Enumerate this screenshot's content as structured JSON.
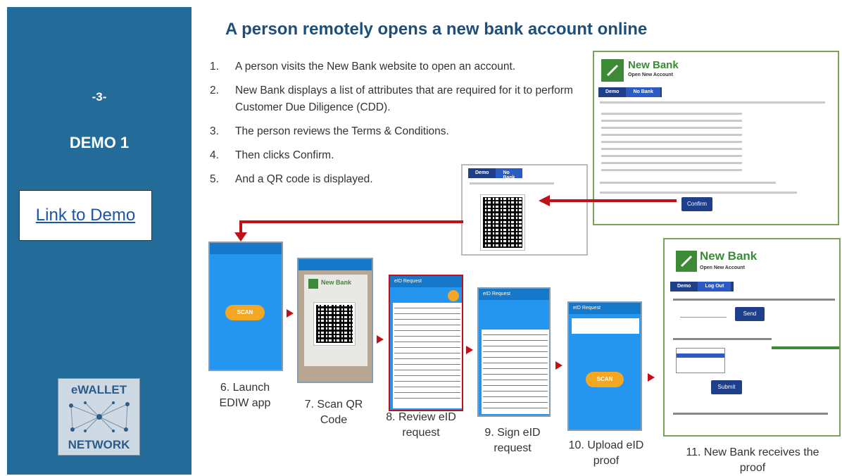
{
  "sidebar": {
    "slide_number": "-3-",
    "demo_title": "DEMO 1",
    "link_label": "Link to Demo",
    "logo_top": "eWALLET",
    "logo_bottom": "NETWORK"
  },
  "title": "A person remotely opens a new bank account online",
  "steps": [
    {
      "num": "1.",
      "text": "A person visits the New Bank website to open an account."
    },
    {
      "num": "2.",
      "text": "New Bank displays a list of attributes that are required for it to perform Customer Due Diligence (CDD)."
    },
    {
      "num": "3.",
      "text": "The person reviews the Terms & Conditions."
    },
    {
      "num": "4.",
      "text": "Then clicks Confirm."
    },
    {
      "num": "5.",
      "text": "And a QR code is displayed."
    }
  ],
  "bank_panel_top": {
    "bank_name": "New Bank",
    "subtitle": "Open New Account",
    "tab_demo": "Demo",
    "tab_bank": "No Bank",
    "confirm_label": "Confirm"
  },
  "qr_panel": {
    "tab_demo": "Demo",
    "tab_bank": "No Bank"
  },
  "bank_panel_bottom": {
    "bank_name": "New Bank",
    "subtitle": "Open New Account",
    "tab_demo": "Demo",
    "tab_logout": "Log Out",
    "send_label": "Send",
    "submit_label": "Submit"
  },
  "phones": {
    "p1_scan": "SCAN",
    "p2_bank": "New Bank",
    "p3_header": "eID Request",
    "p4_header": "eID Request",
    "p5_header": "eID Request",
    "p5_scan": "SCAN"
  },
  "captions": {
    "c6": "6. Launch EDIW app",
    "c7": "7. Scan QR Code",
    "c8": "8. Review eID request",
    "c9": "9. Sign eID request",
    "c10": "10. Upload eID proof",
    "c11": "11. New Bank receives the proof"
  },
  "colors": {
    "sidebar": "#236b99",
    "title": "#1f4e79",
    "arrow": "#c0111a",
    "bank_green": "#3c8a35",
    "phone_blue": "#2596f0"
  }
}
